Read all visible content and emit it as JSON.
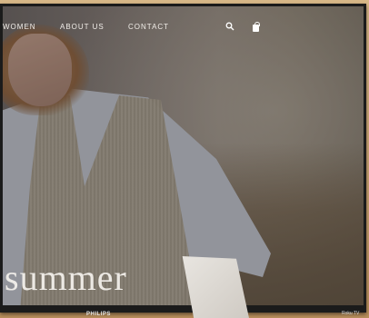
{
  "nav": {
    "items": [
      "WOMEN",
      "ABOUT US",
      "CONTACT"
    ]
  },
  "icons": {
    "search": "search-icon",
    "bag": "shopping-bag-icon"
  },
  "hero": {
    "headline": "summer"
  },
  "device": {
    "brand": "PHILIPS",
    "badge": "Roku TV"
  },
  "colors": {
    "nav_text": "#f1ede8",
    "bezel": "#1b1b1b"
  }
}
